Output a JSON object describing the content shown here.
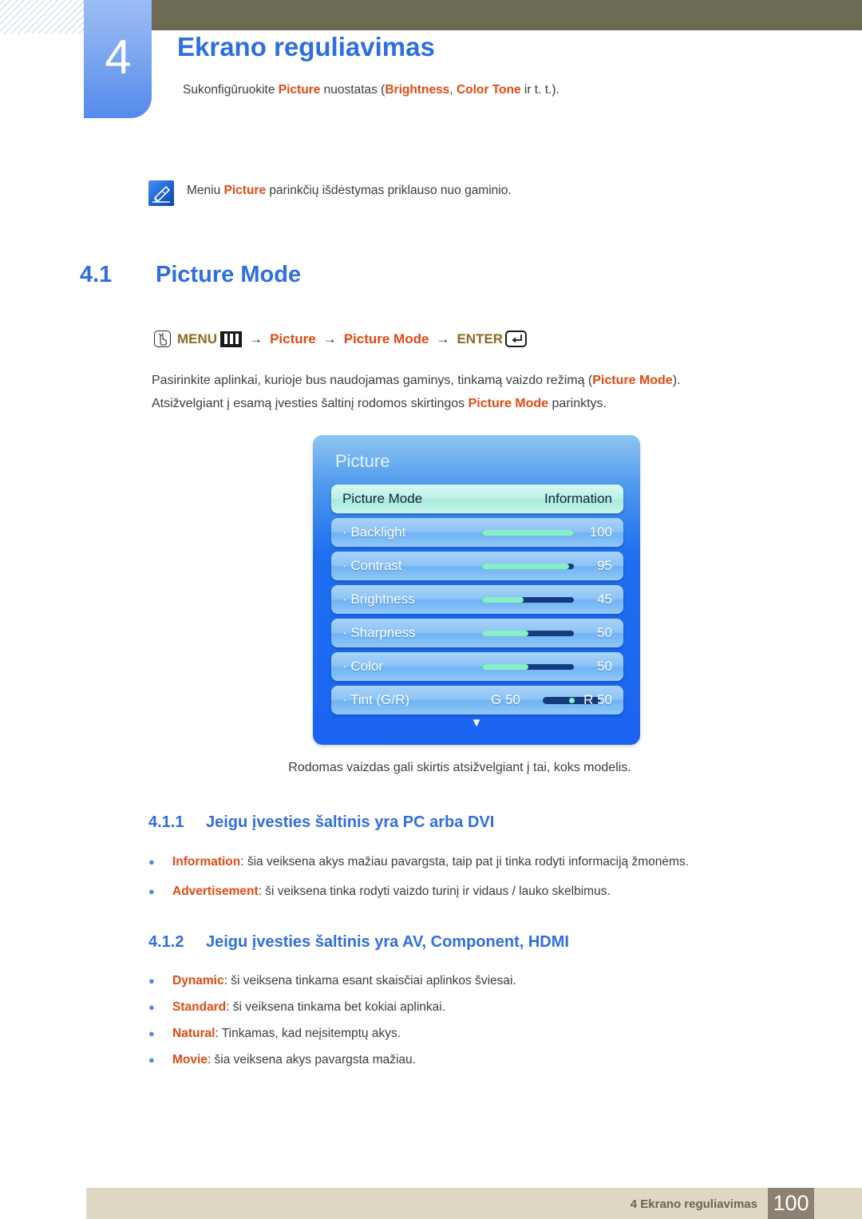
{
  "chapter": {
    "number": "4",
    "title": "Ekrano reguliavimas",
    "intro_prefix": "Sukonfigūruokite ",
    "intro_term1": "Picture",
    "intro_mid": " nuostatas (",
    "intro_term2": "Brightness",
    "intro_comma": ", ",
    "intro_term3": "Color Tone",
    "intro_suffix": " ir t. t.)."
  },
  "note": {
    "icon": "note-pencil-icon",
    "text_prefix": "Meniu ",
    "text_term": "Picture",
    "text_suffix": " parinkčių išdėstymas priklauso nuo gaminio."
  },
  "section": {
    "number": "4.1",
    "title": "Picture Mode"
  },
  "menu_path": {
    "hand_icon": "hand-press-icon",
    "menu_label": "MENU",
    "bars_icon": "menu-bars-icon",
    "arrow": "→",
    "item1": "Picture",
    "item2": "Picture Mode",
    "enter_label": "ENTER",
    "enter_icon": "enter-key-icon"
  },
  "paragraphs": {
    "p1_a": "Pasirinkite aplinkai, kurioje bus naudojamas gaminys, tinkamą vaizdo režimą (",
    "p1_term": "Picture Mode",
    "p1_b": ").",
    "p2_a": "Atsižvelgiant į esamą įvesties šaltinį rodomos skirtingos ",
    "p2_term": "Picture Mode",
    "p2_b": " parinktys."
  },
  "osd": {
    "title": "Picture",
    "rows": [
      {
        "label": "Picture Mode",
        "value": "Information",
        "type": "selected"
      },
      {
        "label": "· Backlight",
        "value": "100",
        "type": "slider",
        "percent": 100
      },
      {
        "label": "· Contrast",
        "value": "95",
        "type": "slider",
        "percent": 95
      },
      {
        "label": "· Brightness",
        "value": "45",
        "type": "slider",
        "percent": 45
      },
      {
        "label": "· Sharpness",
        "value": "50",
        "type": "slider",
        "percent": 50
      },
      {
        "label": "· Color",
        "value": "50",
        "type": "slider",
        "percent": 50
      },
      {
        "label": "· Tint (G/R)",
        "left": "G 50",
        "right": "R 50",
        "type": "tint",
        "percent": 50
      }
    ],
    "scroll_down_icon": "▼",
    "colors": {
      "panel_blue": "#1b63f2",
      "row_blue": "#8cc3f6",
      "row_selected": "#bdf0e6",
      "slider_fill": "#86efc3",
      "slider_track": "#153a7e"
    }
  },
  "caption": "Rodomas vaizdas gali skirtis atsižvelgiant į tai, koks modelis.",
  "subsections": [
    {
      "number": "4.1.1",
      "title": "Jeigu įvesties šaltinis yra PC arba DVI",
      "bullets": [
        {
          "term": "Information",
          "rest": ": šia veiksena akys mažiau pavargsta, taip pat ji tinka rodyti informaciją žmonėms."
        },
        {
          "term": "Advertisement",
          "rest": ": ši veiksena tinka rodyti vaizdo turinį ir vidaus / lauko skelbimus."
        }
      ]
    },
    {
      "number": "4.1.2",
      "title": "Jeigu įvesties šaltinis yra AV, Component, HDMI",
      "bullets": [
        {
          "term": "Dynamic",
          "rest": ": ši veiksena tinkama esant skaisčiai aplinkos šviesai."
        },
        {
          "term": "Standard",
          "rest": ": ši veiksena tinkama bet kokiai aplinkai."
        },
        {
          "term": "Natural",
          "rest": ": Tinkamas, kad neįsitemptų akys."
        },
        {
          "term": "Movie",
          "rest": ": šia veiksena akys pavargsta mažiau."
        }
      ]
    }
  ],
  "footer": {
    "text": "4 Ekrano reguliavimas",
    "page": "100"
  },
  "theme": {
    "accent_blue": "#2f6ee0",
    "accent_orange": "#e04a12",
    "olive": "#6d6a54",
    "footer_bg": "#ded7c4",
    "footer_page_bg": "#8c8172"
  }
}
